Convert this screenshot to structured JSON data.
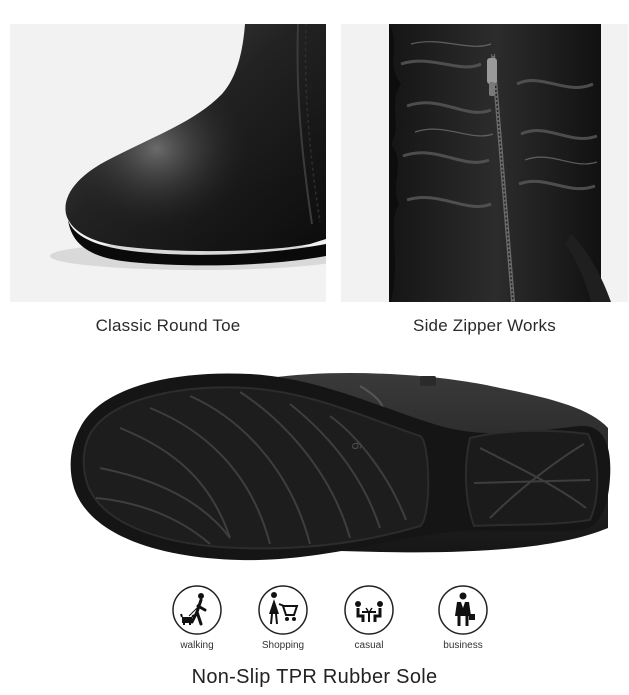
{
  "captions": {
    "toe": "Classic Round Toe",
    "zipper": "Side Zipper Works"
  },
  "sole": {
    "size_mark": "6"
  },
  "usage": [
    {
      "label": "walking",
      "icon": "walking-dog-icon"
    },
    {
      "label": "Shopping",
      "icon": "shopping-cart-icon"
    },
    {
      "label": "casual",
      "icon": "casual-dining-icon"
    },
    {
      "label": "business",
      "icon": "business-person-icon"
    }
  ],
  "footer": {
    "title": "Non-Slip TPR Rubber Sole"
  },
  "colors": {
    "leather": "#1b1b1b",
    "background": "#ffffff",
    "panel": "#f2f2f2"
  }
}
